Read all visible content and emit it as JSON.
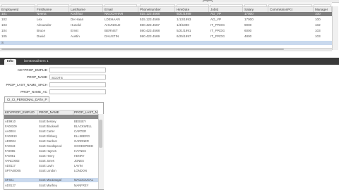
{
  "top_grid": {
    "refresh_icon_label": "⟳",
    "columns": [
      "EmployeeId",
      "FirstName",
      "LastName",
      "Email",
      "PhoneNumber",
      "HireDate",
      "JobId",
      "Salary",
      "CommissionPct",
      "Manager"
    ],
    "rows": [
      [
        "101",
        "Neena",
        "Kochhar",
        "NKOCHHAR",
        "515.123.4568",
        "9/21/1989",
        "AD_VP",
        "17000",
        "",
        "100"
      ],
      [
        "102",
        "Lex",
        "De Haan",
        "LDEHAAN",
        "515.123.4569",
        "1/13/1993",
        "AD_VP",
        "17000",
        "",
        "100"
      ],
      [
        "103",
        "Alexander",
        "Hunold",
        "AHUNOLD",
        "590.423.4567",
        "1/3/1990",
        "IT_PROG",
        "9000",
        "",
        "102"
      ],
      [
        "104",
        "Bruce",
        "Ernst",
        "BERNST",
        "590.423.4568",
        "5/21/1991",
        "IT_PROG",
        "6000",
        "",
        "103"
      ],
      [
        "105",
        "David",
        "Austin",
        "DAUSTIN",
        "590.423.4569",
        "6/25/1997",
        "IT_PROG",
        "4800",
        "",
        "103"
      ],
      [
        "S",
        "",
        "",
        "",
        "",
        "",
        "",
        "",
        "",
        ""
      ]
    ]
  },
  "tabs": {
    "tab1": "Info",
    "tab2": "itemDetailItem 1"
  },
  "form": {
    "keyprop_label": "KEYPROP_EMPLID",
    "prop_name_label": "PROP_NAME",
    "prop_name_value": "SCOTS",
    "prop_last_label": "PROP_LAST_NAME_SRCH",
    "prop_name_ac_label": "PROP_NAME_AC"
  },
  "lower_grid": {
    "title": "CI_CI_PERSONAL_DATA_P",
    "columns": [
      "KEYPROP_EMPLID",
      "PROP_NAME",
      "PROP_LAST_N"
    ],
    "rows": [
      [
        "",
        "",
        ""
      ],
      [
        "AE9910",
        "Scott Bessey",
        "BESSEY"
      ],
      [
        "FA00109",
        "Scott Blackwell",
        "BLACKWELL"
      ],
      [
        "AA0004",
        "Scott Carter",
        "CARTER"
      ],
      [
        "FA00910",
        "Scott Ellsberg",
        "ELLSBERG"
      ],
      [
        "AD0004",
        "Scott Gardner",
        "GARDNER"
      ],
      [
        "FA0043",
        "Scott Goodspeed",
        "GOODSPEED"
      ],
      [
        "FA9065",
        "Scott Haynes",
        "HAYNES"
      ],
      [
        "FA0061",
        "Scott Henry",
        "HENRY"
      ],
      [
        "VANC0002",
        "Scott Jones",
        "JONES"
      ],
      [
        "AD0117",
        "Scott Lavin",
        "LAVIN"
      ],
      [
        "SPTA00005",
        "Scott London",
        "LONDON"
      ],
      [
        "SF401",
        "Scott MacDougal",
        "MACDOUGAL"
      ],
      [
        "AD0127",
        "Scott Manfrey",
        "MANFREY"
      ]
    ]
  }
}
